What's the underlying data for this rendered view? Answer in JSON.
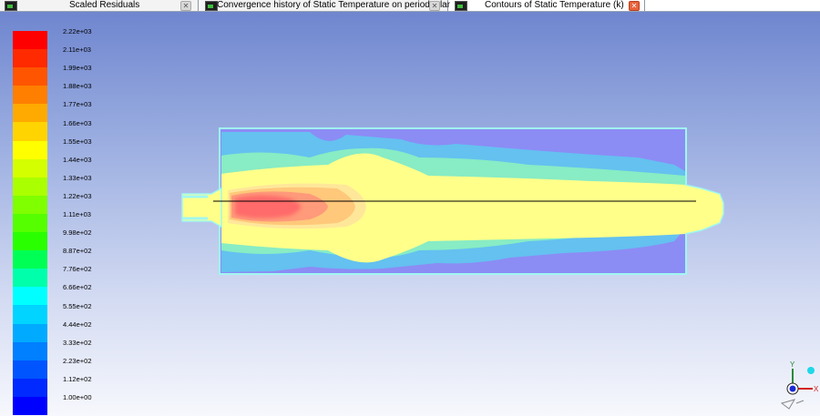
{
  "tabs": [
    {
      "label": "Scaled Residuals",
      "close": "gray"
    },
    {
      "label": "Convergence history of Static Temperature on period_plane",
      "close": "gray"
    },
    {
      "label": "Contours of Static Temperature (k)",
      "close": "red"
    }
  ],
  "legend": {
    "labels": [
      "2.22e+03",
      "2.11e+03",
      "1.99e+03",
      "1.88e+03",
      "1.77e+03",
      "1.66e+03",
      "1.55e+03",
      "1.44e+03",
      "1.33e+03",
      "1.22e+03",
      "1.11e+03",
      "9.98e+02",
      "8.87e+02",
      "7.76e+02",
      "6.66e+02",
      "5.55e+02",
      "4.44e+02",
      "3.33e+02",
      "2.23e+02",
      "1.12e+02",
      "1.00e+00"
    ],
    "colors": [
      "#ff0000",
      "#ff2a00",
      "#ff5500",
      "#ff7f00",
      "#ffaa00",
      "#ffd400",
      "#ffff00",
      "#d4ff00",
      "#aaff00",
      "#7fff00",
      "#55ff00",
      "#2aff00",
      "#00ff55",
      "#00ffaa",
      "#00ffff",
      "#00d4ff",
      "#00aaff",
      "#007fff",
      "#0055ff",
      "#002aff",
      "#0000ff"
    ]
  },
  "contour": {
    "title_tab": "Contours of Static Temperature (k)",
    "colors": {
      "domain_border": "#9ff7f0",
      "cold": "#8c8cf5",
      "cool": "#5fc7f0",
      "mid": "#88ecc4",
      "warm": "#ffff8a",
      "hot": "#ffc87a",
      "hotter": "#ff9a7a",
      "core": "#ff6a6a"
    }
  },
  "triad": {
    "axes": [
      "Y",
      "X"
    ],
    "icons": [
      "axis-triad-icon"
    ]
  }
}
